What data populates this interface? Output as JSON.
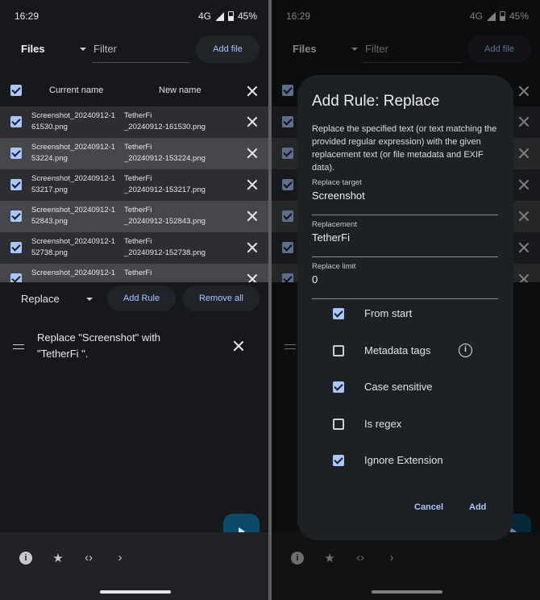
{
  "status": {
    "time": "16:29",
    "network": "4G",
    "battery": "45%"
  },
  "toolbar": {
    "files_label": "Files",
    "filter_placeholder": "Filter",
    "add_file_label": "Add file"
  },
  "table": {
    "col_current": "Current name",
    "col_new": "New name",
    "rows": [
      {
        "current": "Screenshot_20240912-1\n61530.png",
        "new": "TetherFi\n_20240912-161530.png"
      },
      {
        "current": "Screenshot_20240912-1\n53224.png",
        "new": "TetherFi\n_20240912-153224.png"
      },
      {
        "current": "Screenshot_20240912-1\n53217.png",
        "new": "TetherFi\n_20240912-153217.png"
      },
      {
        "current": "Screenshot_20240912-1\n52843.png",
        "new": "TetherFi\n_20240912-152843.png"
      },
      {
        "current": "Screenshot_20240912-1\n52738.png",
        "new": "TetherFi\n_20240912-152738.png"
      },
      {
        "current": "Screenshot_20240912-1",
        "new": "TetherFi"
      }
    ]
  },
  "rules": {
    "selected_type": "Replace",
    "add_rule_label": "Add Rule",
    "remove_all_label": "Remove all",
    "items": [
      {
        "text": "Replace \"Screenshot\" with\n\"TetherFi \"."
      }
    ]
  },
  "dialog": {
    "title": "Add Rule: Replace",
    "description": "Replace the specified text (or text matching the provided regular expression) with the given replacement text (or file metadata and EXIF data).",
    "fields": [
      {
        "label": "Replace target",
        "value": "Screenshot"
      },
      {
        "label": "Replacement",
        "value": "TetherFi"
      },
      {
        "label": "Replace limit",
        "value": "0"
      }
    ],
    "options": [
      {
        "label": "From start",
        "checked": true
      },
      {
        "label": "Metadata tags",
        "checked": false
      },
      {
        "label": "Case sensitive",
        "checked": true
      },
      {
        "label": "Is regex",
        "checked": false
      },
      {
        "label": "Ignore Extension",
        "checked": true
      }
    ],
    "cancel_label": "Cancel",
    "add_label": "Add"
  },
  "colors": {
    "accent": "#a9c7ff",
    "fab": "#0b4a6b",
    "background": "#16181c"
  }
}
